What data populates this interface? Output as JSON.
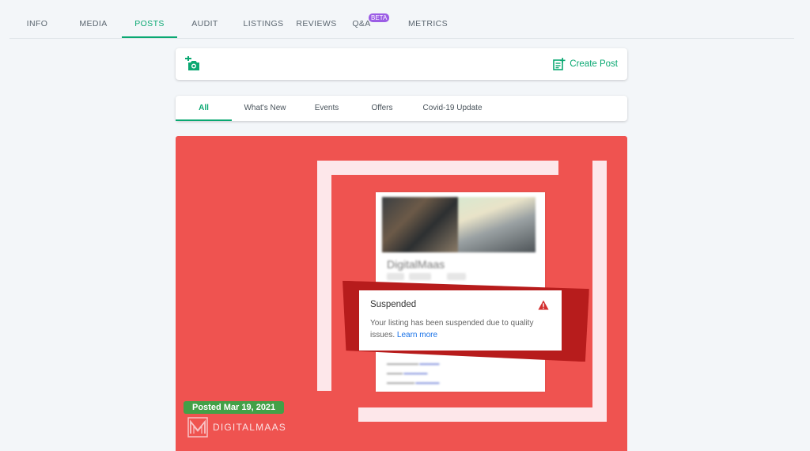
{
  "nav": {
    "tabs": [
      {
        "label": "INFO"
      },
      {
        "label": "MEDIA"
      },
      {
        "label": "POSTS"
      },
      {
        "label": "AUDIT"
      },
      {
        "label": "LISTINGS"
      },
      {
        "label": "REVIEWS"
      },
      {
        "label": "Q&A",
        "badge": "BETA"
      },
      {
        "label": "METRICS"
      }
    ],
    "active": "POSTS"
  },
  "toolbar": {
    "add_photo_icon": "add-a-photo-icon",
    "create_post_label": "Create Post",
    "create_post_icon": "post-add-icon"
  },
  "filters": {
    "tabs": [
      "All",
      "What's New",
      "Events",
      "Offers",
      "Covid-19 Update"
    ],
    "active": "All"
  },
  "post": {
    "posted_label": "Posted Mar 19, 2021",
    "brand_name": "DIGITALMAAS",
    "image": {
      "business_name": "DigitalMaas",
      "notice_title": "Suspended",
      "notice_text": "Your listing has been suspended due to quality issues.",
      "notice_link": "Learn more"
    }
  },
  "colors": {
    "accent": "#0aa872",
    "post_background": "#ef5350",
    "frame": "#b71c1c",
    "posted_badge": "#43a047",
    "beta_badge": "#9b5de5"
  }
}
